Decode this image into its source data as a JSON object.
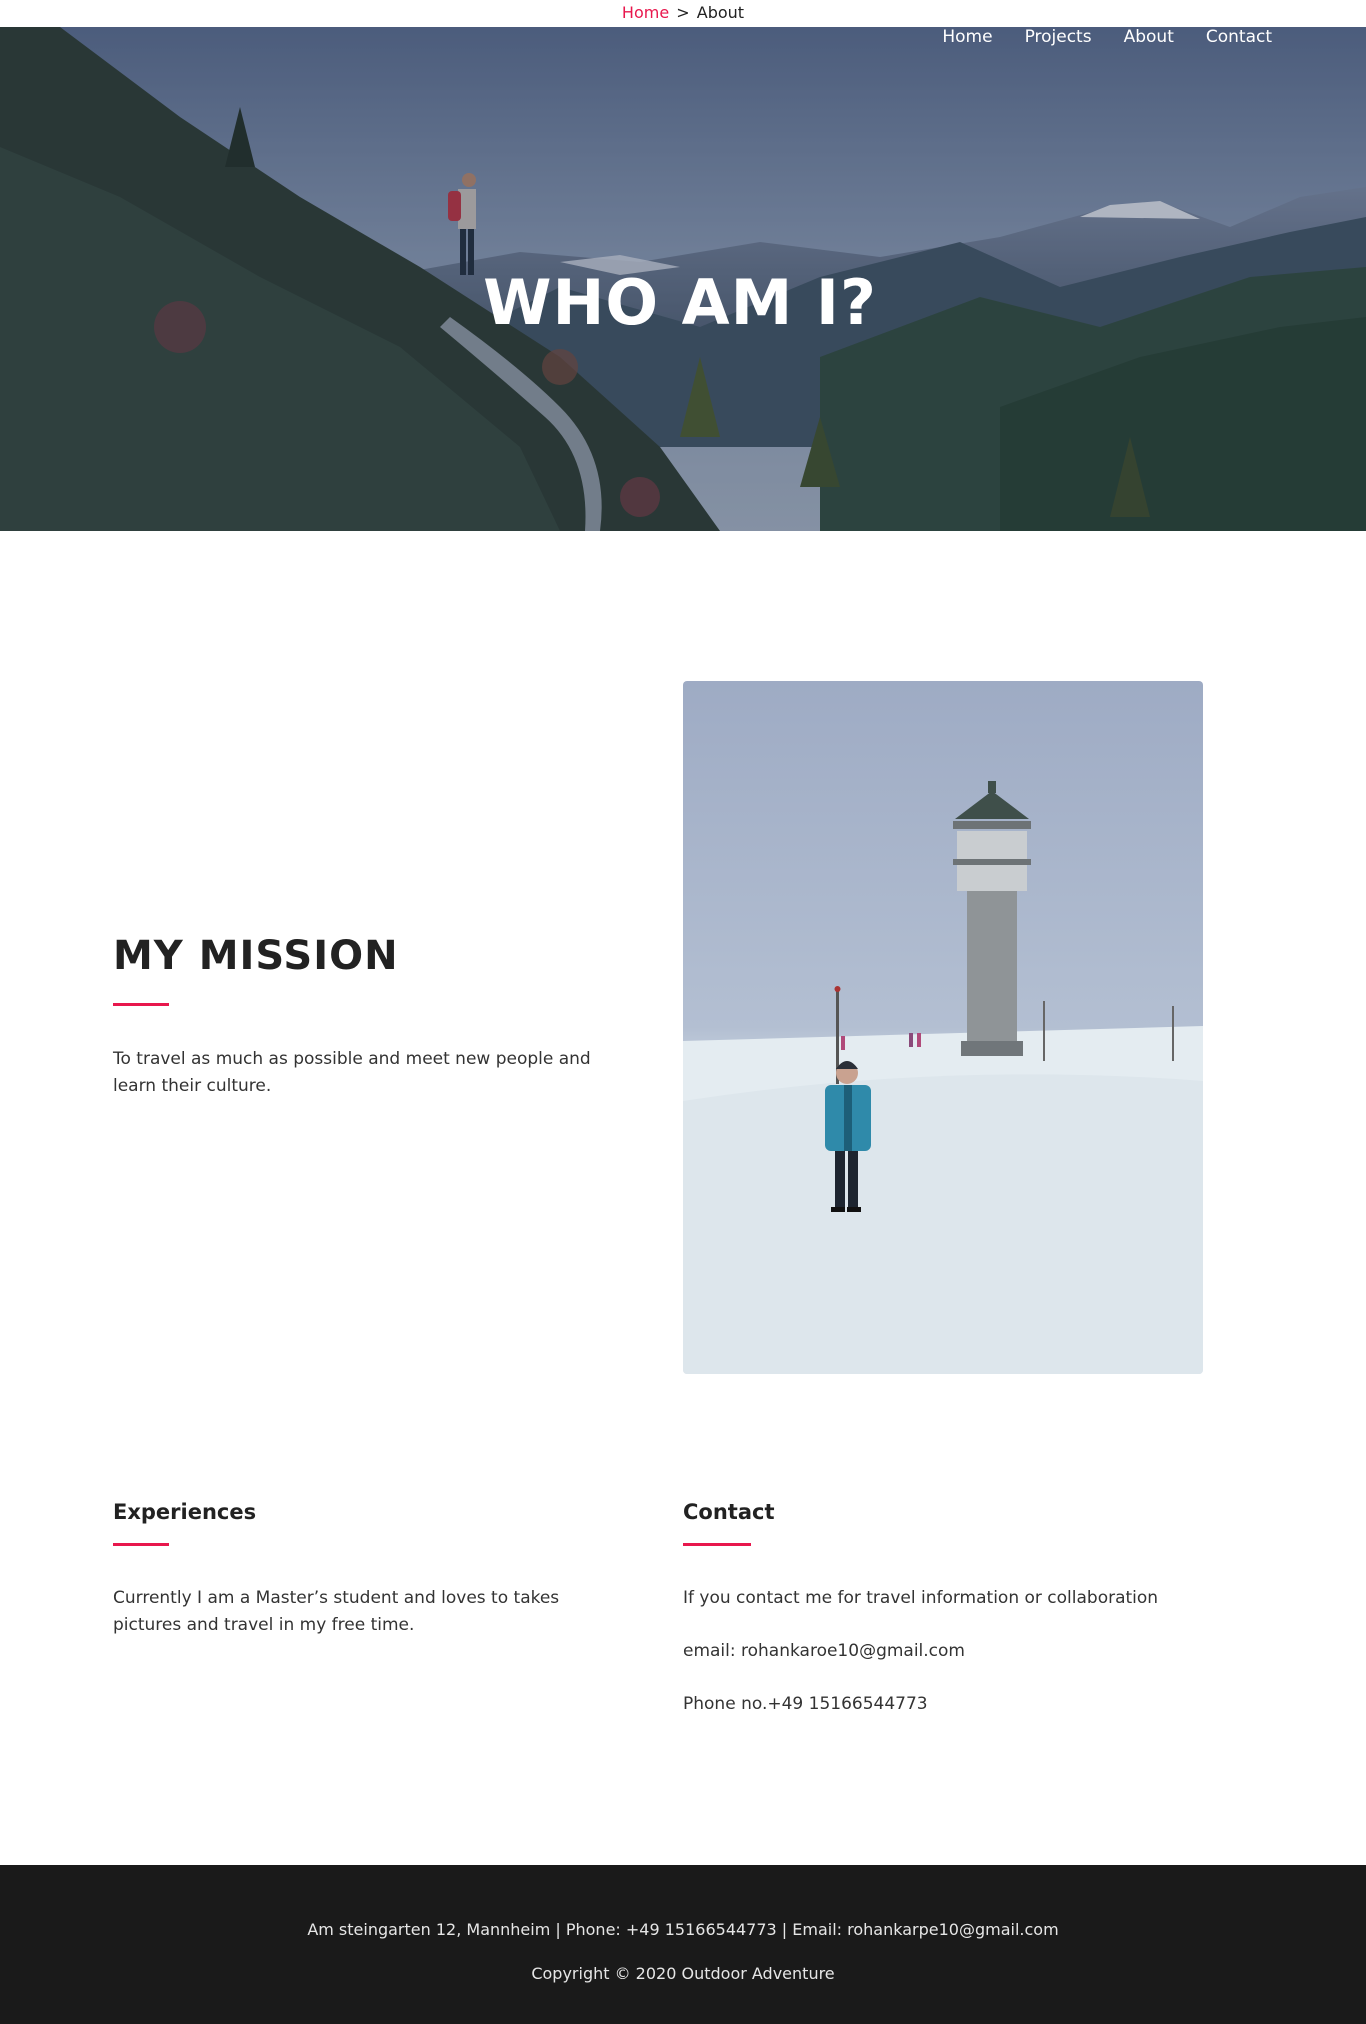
{
  "breadcrumb": {
    "home": "Home",
    "separator": ">",
    "current": "About"
  },
  "nav": {
    "items": [
      "Home",
      "Projects",
      "About",
      "Contact"
    ]
  },
  "hero": {
    "title": "WHO AM I?"
  },
  "mission": {
    "title": "MY MISSION",
    "text": "To travel as much as possible and meet new people and learn their culture."
  },
  "experiences": {
    "title": "Experiences",
    "text": "Currently I am a Master’s student and loves to takes pictures and travel in my free time."
  },
  "contact": {
    "title": "Contact",
    "intro": "If you contact me for travel information or collaboration",
    "email": "email: rohankaroe10@gmail.com",
    "phone": "Phone no.+49 15166544773"
  },
  "footer": {
    "address": "Am steingarten 12, Mannheim | Phone: +49 15166544773 | Email: rohankarpe10@gmail.com",
    "copyright": "Copyright © 2020 Outdoor Adventure"
  },
  "colors": {
    "accent": "#e8174d",
    "footer_bg": "#1a1a1a",
    "text": "#333333"
  }
}
